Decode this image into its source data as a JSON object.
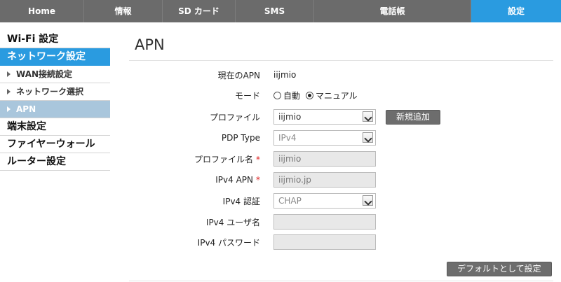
{
  "topnav": {
    "tabs": [
      {
        "label": "Home"
      },
      {
        "label": "情報"
      },
      {
        "label": "SD カード"
      },
      {
        "label": "SMS"
      },
      {
        "label": "電話帳"
      },
      {
        "label": "設定"
      }
    ],
    "active_tab": "設定"
  },
  "sidebar": {
    "wifi": "Wi-Fi 設定",
    "network": "ネットワーク設定",
    "wan": "WAN接続設定",
    "network_select": "ネットワーク選択",
    "apn": "APN",
    "device": "端末設定",
    "firewall": "ファイヤーウォール",
    "router": "ルーター設定"
  },
  "main": {
    "title": "APN",
    "current_apn": {
      "label": "現在のAPN",
      "value": "iijmio"
    },
    "mode": {
      "label": "モード",
      "options": [
        "自動",
        "マニュアル"
      ],
      "selected": "マニュアル"
    },
    "profile": {
      "label": "プロファイル",
      "value": "iijmio",
      "add_button": "新規追加"
    },
    "pdp_type": {
      "label": "PDP Type",
      "value": "IPv4"
    },
    "profile_name": {
      "label": "プロファイル名",
      "required_mark": "*",
      "value": "iijmio"
    },
    "ipv4_apn": {
      "label": "IPv4 APN",
      "required_mark": "*",
      "value": "iijmio.jp"
    },
    "ipv4_auth": {
      "label": "IPv4 認証",
      "value": "CHAP"
    },
    "ipv4_user": {
      "label": "IPv4 ユーザ名",
      "value": ""
    },
    "ipv4_password": {
      "label": "IPv4 パスワード",
      "value": ""
    },
    "default_button": "デフォルトとして設定"
  },
  "colors": {
    "nav_bg": "#6b6b6b",
    "accent": "#2a9be0",
    "sub_active": "#a9c6dc",
    "required": "#d22222",
    "button_bg": "#6d6d6d"
  }
}
